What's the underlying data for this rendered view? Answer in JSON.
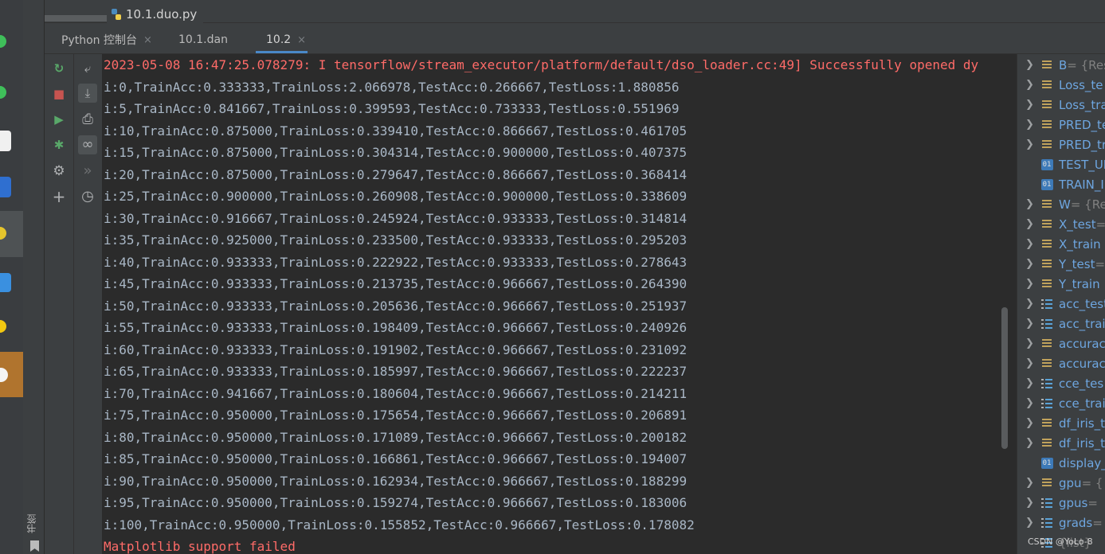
{
  "top_tab": {
    "file_name": "10.1.duo.py",
    "icon": "python-file-icon"
  },
  "console_tabs": [
    {
      "label": "Python 控制台",
      "close": "×",
      "active": false
    },
    {
      "label": "10.1.dan",
      "close": "",
      "active": false
    },
    {
      "label": "10.2",
      "close": "×",
      "active": true
    }
  ],
  "toolbar1": [
    {
      "name": "rerun-icon",
      "glyph": "↻",
      "color": "#59a869"
    },
    {
      "name": "stop-icon",
      "glyph": "■",
      "color": "#c75450"
    },
    {
      "name": "run-icon",
      "glyph": "▶",
      "color": "#59a869"
    },
    {
      "name": "debug-icon",
      "glyph": "✱",
      "color": "#59a869"
    },
    {
      "name": "settings-icon",
      "glyph": "⚙",
      "color": "#afb1b3"
    },
    {
      "name": "add-icon",
      "glyph": "+",
      "color": "#afb1b3"
    }
  ],
  "toolbar2": [
    {
      "name": "soft-wrap-icon",
      "glyph": "⤶",
      "color": "#afb1b3"
    },
    {
      "name": "scroll-to-end-icon",
      "glyph": "⤓",
      "color": "#afb1b3"
    },
    {
      "name": "print-icon",
      "glyph": "⎙",
      "color": "#afb1b3"
    },
    {
      "name": "show-variables-icon",
      "glyph": "∞",
      "color": "#afb1b3"
    },
    {
      "name": "execute-icon",
      "glyph": "»",
      "color": "#6e7072"
    },
    {
      "name": "history-icon",
      "glyph": "◷",
      "color": "#afb1b3"
    }
  ],
  "console_lines": [
    {
      "text": "2023-05-08 16:47:25.078279: I tensorflow/stream_executor/platform/default/dso_loader.cc:49] Successfully opened dy",
      "error": true
    },
    {
      "text": "i:0,TrainAcc:0.333333,TrainLoss:2.066978,TestAcc:0.266667,TestLoss:1.880856",
      "error": false
    },
    {
      "text": "i:5,TrainAcc:0.841667,TrainLoss:0.399593,TestAcc:0.733333,TestLoss:0.551969",
      "error": false
    },
    {
      "text": "i:10,TrainAcc:0.875000,TrainLoss:0.339410,TestAcc:0.866667,TestLoss:0.461705",
      "error": false
    },
    {
      "text": "i:15,TrainAcc:0.875000,TrainLoss:0.304314,TestAcc:0.900000,TestLoss:0.407375",
      "error": false
    },
    {
      "text": "i:20,TrainAcc:0.875000,TrainLoss:0.279647,TestAcc:0.866667,TestLoss:0.368414",
      "error": false
    },
    {
      "text": "i:25,TrainAcc:0.900000,TrainLoss:0.260908,TestAcc:0.900000,TestLoss:0.338609",
      "error": false
    },
    {
      "text": "i:30,TrainAcc:0.916667,TrainLoss:0.245924,TestAcc:0.933333,TestLoss:0.314814",
      "error": false
    },
    {
      "text": "i:35,TrainAcc:0.925000,TrainLoss:0.233500,TestAcc:0.933333,TestLoss:0.295203",
      "error": false
    },
    {
      "text": "i:40,TrainAcc:0.933333,TrainLoss:0.222922,TestAcc:0.933333,TestLoss:0.278643",
      "error": false
    },
    {
      "text": "i:45,TrainAcc:0.933333,TrainLoss:0.213735,TestAcc:0.966667,TestLoss:0.264390",
      "error": false
    },
    {
      "text": "i:50,TrainAcc:0.933333,TrainLoss:0.205636,TestAcc:0.966667,TestLoss:0.251937",
      "error": false
    },
    {
      "text": "i:55,TrainAcc:0.933333,TrainLoss:0.198409,TestAcc:0.966667,TestLoss:0.240926",
      "error": false
    },
    {
      "text": "i:60,TrainAcc:0.933333,TrainLoss:0.191902,TestAcc:0.966667,TestLoss:0.231092",
      "error": false
    },
    {
      "text": "i:65,TrainAcc:0.933333,TrainLoss:0.185997,TestAcc:0.966667,TestLoss:0.222237",
      "error": false
    },
    {
      "text": "i:70,TrainAcc:0.941667,TrainLoss:0.180604,TestAcc:0.966667,TestLoss:0.214211",
      "error": false
    },
    {
      "text": "i:75,TrainAcc:0.950000,TrainLoss:0.175654,TestAcc:0.966667,TestLoss:0.206891",
      "error": false
    },
    {
      "text": "i:80,TrainAcc:0.950000,TrainLoss:0.171089,TestAcc:0.966667,TestLoss:0.200182",
      "error": false
    },
    {
      "text": "i:85,TrainAcc:0.950000,TrainLoss:0.166861,TestAcc:0.966667,TestLoss:0.194007",
      "error": false
    },
    {
      "text": "i:90,TrainAcc:0.950000,TrainLoss:0.162934,TestAcc:0.966667,TestLoss:0.188299",
      "error": false
    },
    {
      "text": "i:95,TrainAcc:0.950000,TrainLoss:0.159274,TestAcc:0.966667,TestLoss:0.183006",
      "error": false
    },
    {
      "text": "i:100,TrainAcc:0.950000,TrainLoss:0.155852,TestAcc:0.966667,TestLoss:0.178082",
      "error": false
    },
    {
      "text": "Matplotlib support failed",
      "error": true
    }
  ],
  "variables": [
    {
      "name": "B",
      "value": " = {Res",
      "icon": "df",
      "expandable": true
    },
    {
      "name": "Loss_te",
      "value": "",
      "icon": "df",
      "expandable": true
    },
    {
      "name": "Loss_tra",
      "value": "",
      "icon": "df",
      "expandable": true
    },
    {
      "name": "PRED_te",
      "value": "",
      "icon": "df",
      "expandable": true
    },
    {
      "name": "PRED_tr",
      "value": "",
      "icon": "df",
      "expandable": true
    },
    {
      "name": "TEST_UI",
      "value": "",
      "icon": "01",
      "expandable": false
    },
    {
      "name": "TRAIN_I",
      "value": "",
      "icon": "01",
      "expandable": false
    },
    {
      "name": "W",
      "value": " = {Re",
      "icon": "df",
      "expandable": true
    },
    {
      "name": "X_test",
      "value": " =",
      "icon": "df",
      "expandable": true
    },
    {
      "name": "X_train",
      "value": "",
      "icon": "df",
      "expandable": true
    },
    {
      "name": "Y_test",
      "value": " =",
      "icon": "df",
      "expandable": true
    },
    {
      "name": "Y_train",
      "value": "",
      "icon": "df",
      "expandable": true
    },
    {
      "name": "acc_test",
      "value": "",
      "icon": "list",
      "expandable": true
    },
    {
      "name": "acc_trai",
      "value": "",
      "icon": "list",
      "expandable": true
    },
    {
      "name": "accurac",
      "value": "",
      "icon": "df",
      "expandable": true
    },
    {
      "name": "accurac",
      "value": "",
      "icon": "df",
      "expandable": true
    },
    {
      "name": "cce_tes",
      "value": "",
      "icon": "list",
      "expandable": true
    },
    {
      "name": "cce_trai",
      "value": "",
      "icon": "list",
      "expandable": true
    },
    {
      "name": "df_iris_t",
      "value": "",
      "icon": "df",
      "expandable": true
    },
    {
      "name": "df_iris_t",
      "value": "",
      "icon": "df",
      "expandable": true
    },
    {
      "name": "display_",
      "value": "",
      "icon": "01",
      "expandable": false
    },
    {
      "name": "gpu",
      "value": " = {",
      "icon": "df",
      "expandable": true
    },
    {
      "name": "gpus",
      "value": " =",
      "icon": "list",
      "expandable": true
    },
    {
      "name": "grads",
      "value": " =",
      "icon": "list",
      "expandable": true
    },
    {
      "name": "",
      "value": "{list}",
      "icon": "list",
      "expandable": false
    }
  ],
  "bookmarks_label": "书签",
  "watermark": "CSDN @YoLo-8"
}
